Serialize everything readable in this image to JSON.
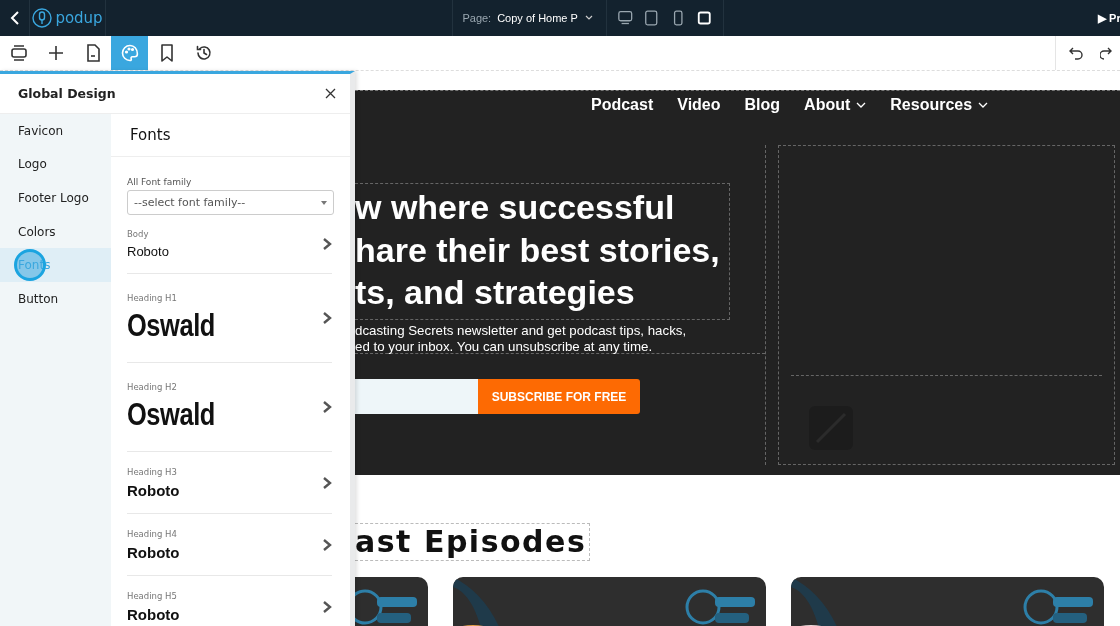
{
  "topbar": {
    "logo": "podup",
    "page_label": "Page:",
    "page_name": "Copy of Home P",
    "devices": [
      {
        "kind": "desktop",
        "selected": false
      },
      {
        "kind": "tablet",
        "selected": false
      },
      {
        "kind": "phone",
        "selected": false
      },
      {
        "kind": "square",
        "selected": true
      }
    ],
    "preview": "▶ Pr"
  },
  "toolbar": [
    {
      "kind": "layers",
      "selected": false
    },
    {
      "kind": "add",
      "selected": false
    },
    {
      "kind": "page",
      "selected": false
    },
    {
      "kind": "palette",
      "selected": true
    },
    {
      "kind": "bookmark",
      "selected": false
    },
    {
      "kind": "history",
      "selected": false
    }
  ],
  "panel": {
    "title": "Global Design",
    "nav": [
      {
        "label": "Favicon",
        "selected": false
      },
      {
        "label": "Logo",
        "selected": false
      },
      {
        "label": "Footer Logo",
        "selected": false
      },
      {
        "label": "Colors",
        "selected": false
      },
      {
        "label": "Fonts",
        "selected": true
      },
      {
        "label": "Button",
        "selected": false
      }
    ],
    "section_title": "Fonts",
    "family_label": "All Font family",
    "family_placeholder": "--select font family--",
    "fonts": [
      {
        "label": "Body",
        "value": "Roboto",
        "kind": "plain"
      },
      {
        "label": "Heading H1",
        "value": "Oswald",
        "kind": "display"
      },
      {
        "label": "Heading H2",
        "value": "Oswald",
        "kind": "display"
      },
      {
        "label": "Heading H3",
        "value": "Roboto",
        "kind": "heading"
      },
      {
        "label": "Heading H4",
        "value": "Roboto",
        "kind": "heading"
      },
      {
        "label": "Heading H5",
        "value": "Roboto",
        "kind": "heading"
      }
    ]
  },
  "site": {
    "nav": [
      {
        "label": "Podcast",
        "dropdown": false
      },
      {
        "label": "Video",
        "dropdown": false
      },
      {
        "label": "Blog",
        "dropdown": false
      },
      {
        "label": "About",
        "dropdown": true
      },
      {
        "label": "Resources",
        "dropdown": true
      }
    ],
    "headline": [
      "w where successful",
      "hare their best stories,",
      "ts, and strategies"
    ],
    "intro": [
      "dcasting Secrets newsletter and get podcast tips, hacks,",
      "ed to your inbox. You can unsubscribe at any time."
    ],
    "subscribe": "SUBSCRIBE FOR FREE",
    "episodes_title": "ast Episodes",
    "episodes": [
      {
        "kind": "picture"
      },
      {
        "kind": "picture"
      },
      {
        "kind": "picture"
      }
    ]
  }
}
